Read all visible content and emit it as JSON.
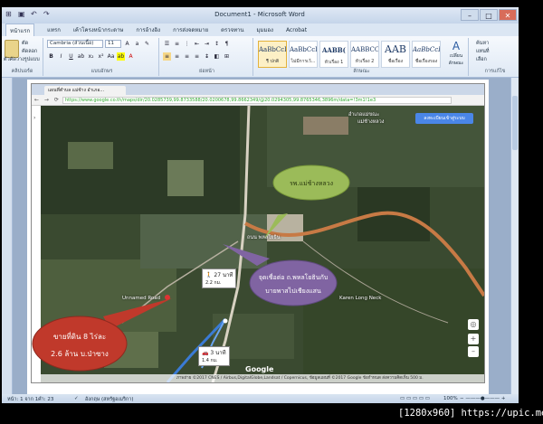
{
  "window": {
    "title": "Document1 - Microsoft Word"
  },
  "ribbon_tabs": [
    "หน้าแรก",
    "แทรก",
    "เค้าโครงหน้ากระดาษ",
    "การอ้างอิง",
    "การส่งจดหมาย",
    "ตรวจทาน",
    "มุมมอง",
    "Acrobat"
  ],
  "clipboard": {
    "cut": "ตัด",
    "copy": "คัดลอก",
    "format_painter": "ตัวคัดวางรูปแบบ",
    "group_label": "คลิปบอร์ด"
  },
  "font": {
    "name": "Cambria (ส่วนเนื้อ)",
    "size": "11",
    "group_label": "แบบอักษร"
  },
  "paragraph": {
    "group_label": "ย่อหน้า"
  },
  "styles": {
    "items": [
      {
        "sample": "AaBbCcD",
        "name": "¶ ปกติ"
      },
      {
        "sample": "AaBbCcD",
        "name": "ไม่มีการเว้..."
      },
      {
        "sample": "AABB(",
        "name": "หัวเรื่อง 1"
      },
      {
        "sample": "AABBCC",
        "name": "หัวเรื่อง 2"
      },
      {
        "sample": "AAB",
        "name": "ชื่อเรื่อง"
      },
      {
        "sample": "AaBbCcD",
        "name": "ชื่อเรื่องรอง"
      }
    ],
    "change_styles": "เปลี่ยนลักษณะ",
    "group_label": "ลักษณะ"
  },
  "editing": {
    "find": "ค้นหา",
    "replace": "แทนที่",
    "select": "เลือก",
    "group_label": "การแก้ไข"
  },
  "browser": {
    "tab_title": "แผนที่ตำบล แม่ช้าง อำเภอ...",
    "url": "https://www.google.co.th/maps/dir/20.0285739,99.8733588/20.0200678,99.8662349/@20.0294305,99.8765346,3896m/data=!3m1!1e3"
  },
  "map": {
    "top_label": "อำเภอแม่ขณะ",
    "top_label2": "แม่ช้างหลวง",
    "road_label": "ถนน พหลโยธิน",
    "mid_label": "Unnamed Road",
    "long_neck": "Karen Long Neck",
    "satellite_button": "ลงทะเบียนเข้าสู่ระบบ",
    "route1_time": "27 นาที",
    "route1_dist": "2.2 กม.",
    "route2_time": "3 นาที",
    "route2_dist": "1.4 กม.",
    "footer": "ภาพถ่าย ©2017 CNES / Airbus,DigitalGlobe,Landsat / Copernicus, ข้อมูลแผนที่ ©2017 Google  ข้อกำหนด  ส่งความคิดเห็น  500 ม.",
    "google": "Google"
  },
  "callouts": {
    "green": "รพ.แม่ช้างหลวง",
    "purple_line1": "จุดเชื่อต่อ ถ.พหลโยธินกับ",
    "purple_line2": "บายพาสไปเชียงแสน",
    "red_line1": "ขายที่ดิน 8 ไร่ละ",
    "red_line2": "2.6 ล้าน บ.ป่าซาง"
  },
  "status": {
    "page": "หน้า: 1 จาก 1",
    "words": "คำ: 23",
    "language": "อังกฤษ (สหรัฐอเมริกา)",
    "zoom": "100%"
  },
  "watermark": "[1280x960] https://upic.me/"
}
